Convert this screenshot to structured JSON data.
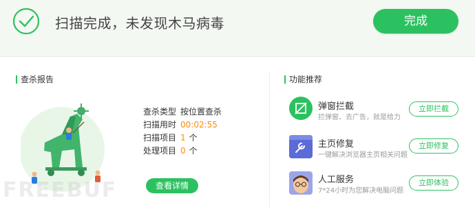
{
  "header": {
    "title": "扫描完成，未发现木马病毒",
    "done_label": "完成"
  },
  "report": {
    "title": "查杀报告",
    "rows": [
      {
        "label": "查杀类型",
        "value": "按位置查杀",
        "unit": ""
      },
      {
        "label": "扫描用时",
        "value": "00:02:55",
        "unit": ""
      },
      {
        "label": "扫描项目",
        "value": "1",
        "unit": "个"
      },
      {
        "label": "处理项目",
        "value": "0",
        "unit": "个"
      }
    ],
    "details_label": "查看详情"
  },
  "features": {
    "title": "功能推荐",
    "items": [
      {
        "name": "弹窗拦截",
        "desc": "拦弹窗、去广告，就是给力",
        "button": "立即拦截",
        "icon": "popup-block-icon"
      },
      {
        "name": "主页修复",
        "desc": "一键解决浏览器主页相关问题",
        "button": "立即修复",
        "icon": "homepage-repair-icon"
      },
      {
        "name": "人工服务",
        "desc": "7*24小时为您解决电脑问题",
        "button": "立即体验",
        "icon": "service-agent-icon"
      }
    ]
  },
  "watermark": "FREEBUF",
  "colors": {
    "accent": "#2cc160",
    "highlight": "#ff8a00",
    "header_bg": "#f3f8f2"
  }
}
